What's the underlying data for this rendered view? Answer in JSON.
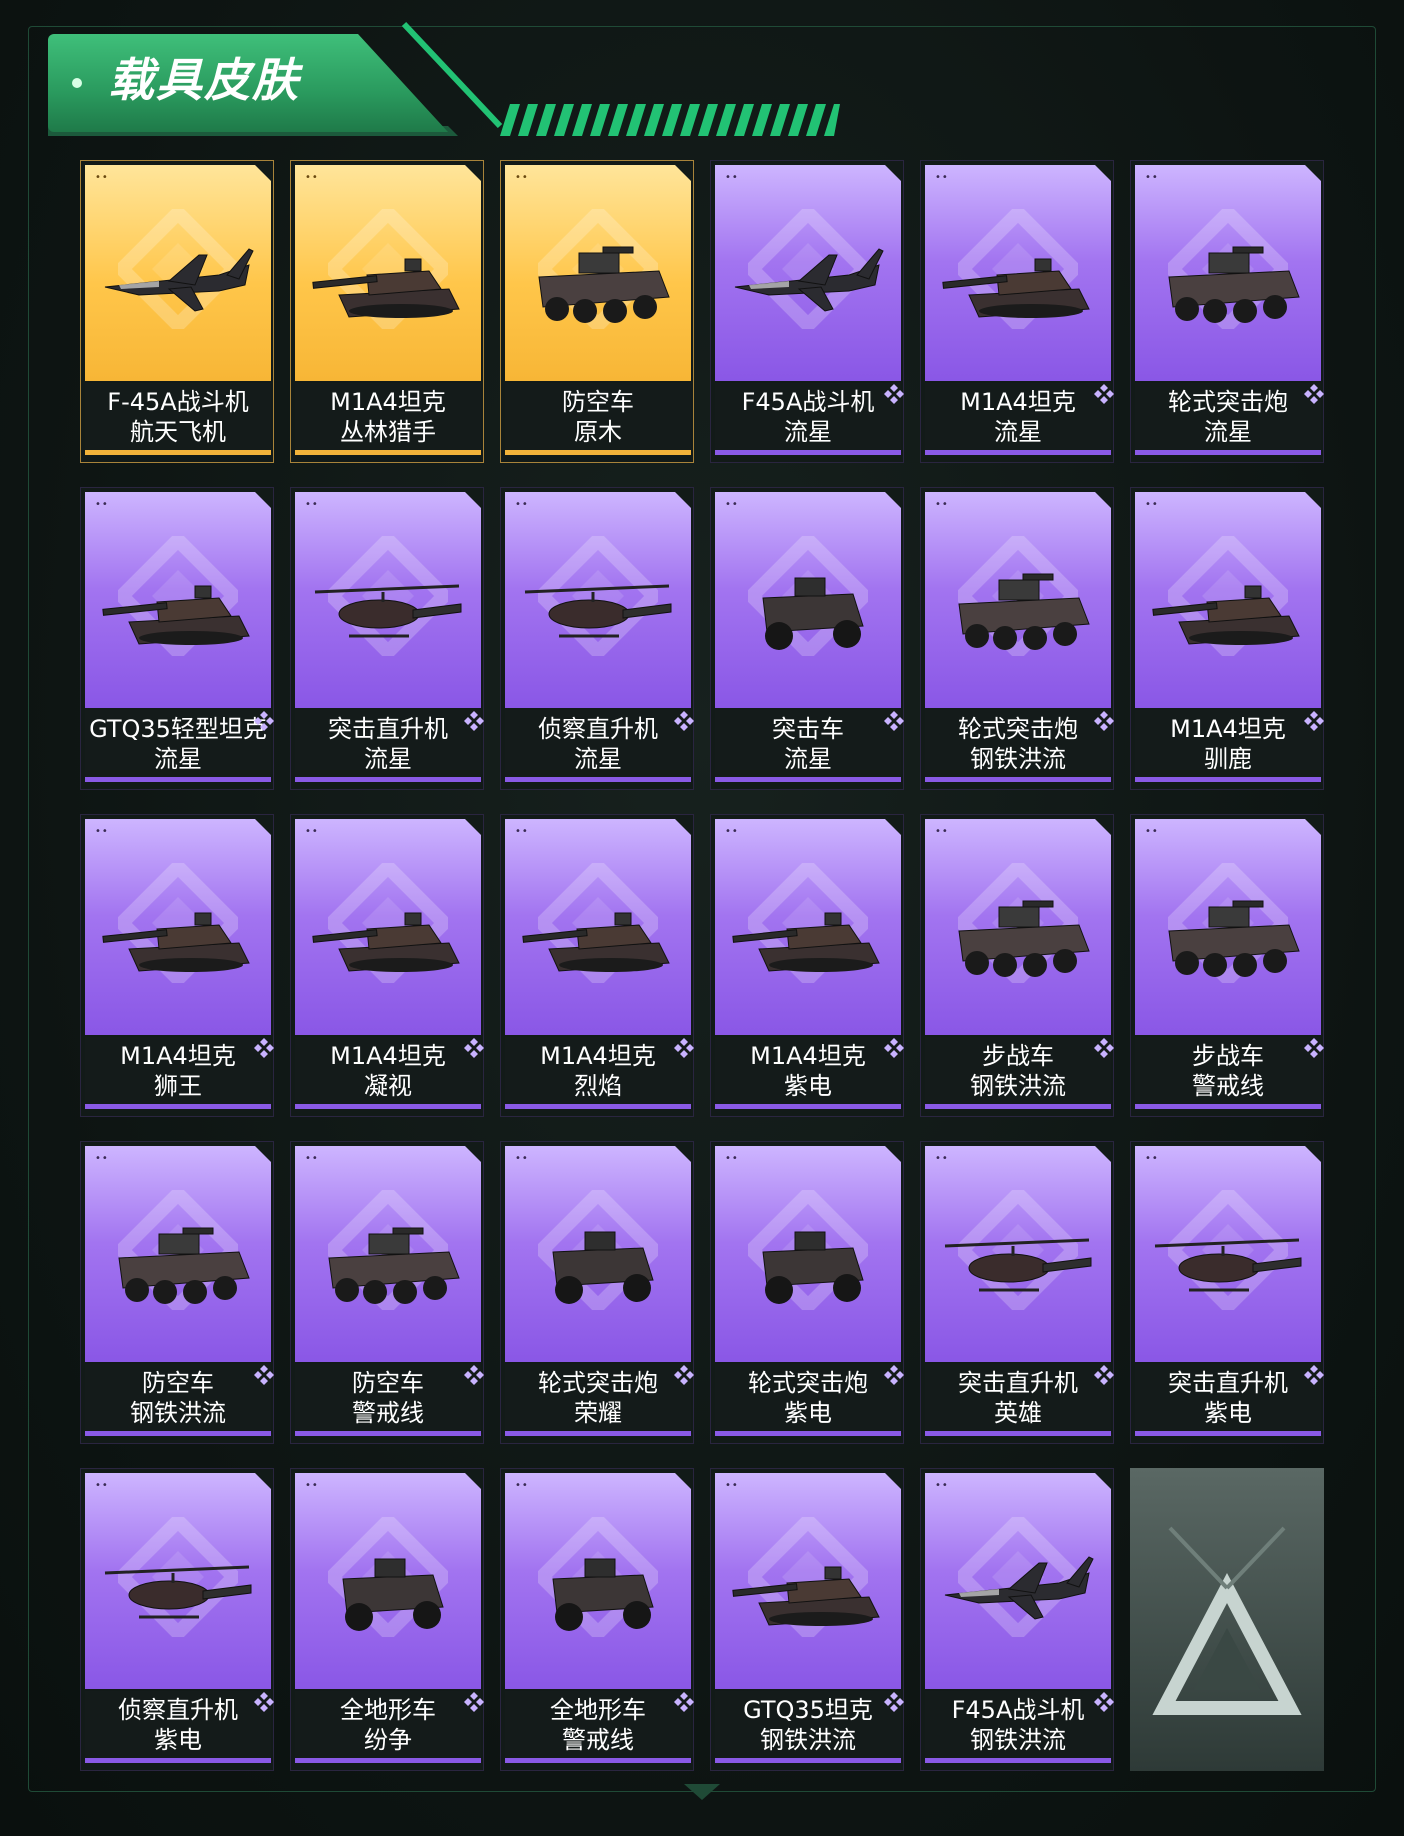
{
  "header": {
    "title": "载具皮肤"
  },
  "colors": {
    "accent_green": "#2fb06c",
    "epic_purple": "#9a68ec",
    "legend_gold": "#ffc64a"
  },
  "cards": [
    {
      "name": "F-45A战斗机",
      "skin": "航天飞机",
      "rarity": "gold",
      "vehicle": "jet"
    },
    {
      "name": "M1A4坦克",
      "skin": "丛林猎手",
      "rarity": "gold",
      "vehicle": "tank"
    },
    {
      "name": "防空车",
      "skin": "原木",
      "rarity": "gold",
      "vehicle": "apc"
    },
    {
      "name": "F45A战斗机",
      "skin": "流星",
      "rarity": "purple",
      "vehicle": "jet"
    },
    {
      "name": "M1A4坦克",
      "skin": "流星",
      "rarity": "purple",
      "vehicle": "tank"
    },
    {
      "name": "轮式突击炮",
      "skin": "流星",
      "rarity": "purple",
      "vehicle": "apc"
    },
    {
      "name": "GTQ35轻型坦克",
      "skin": "流星",
      "rarity": "purple",
      "vehicle": "tank"
    },
    {
      "name": "突击直升机",
      "skin": "流星",
      "rarity": "purple",
      "vehicle": "heli"
    },
    {
      "name": "侦察直升机",
      "skin": "流星",
      "rarity": "purple",
      "vehicle": "heli"
    },
    {
      "name": "突击车",
      "skin": "流星",
      "rarity": "purple",
      "vehicle": "buggy"
    },
    {
      "name": "轮式突击炮",
      "skin": "钢铁洪流",
      "rarity": "purple",
      "vehicle": "apc"
    },
    {
      "name": "M1A4坦克",
      "skin": "驯鹿",
      "rarity": "purple",
      "vehicle": "tank"
    },
    {
      "name": "M1A4坦克",
      "skin": "狮王",
      "rarity": "purple",
      "vehicle": "tank"
    },
    {
      "name": "M1A4坦克",
      "skin": "凝视",
      "rarity": "purple",
      "vehicle": "tank"
    },
    {
      "name": "M1A4坦克",
      "skin": "烈焰",
      "rarity": "purple",
      "vehicle": "tank"
    },
    {
      "name": "M1A4坦克",
      "skin": "紫电",
      "rarity": "purple",
      "vehicle": "tank"
    },
    {
      "name": "步战车",
      "skin": "钢铁洪流",
      "rarity": "purple",
      "vehicle": "apc"
    },
    {
      "name": "步战车",
      "skin": "警戒线",
      "rarity": "purple",
      "vehicle": "apc"
    },
    {
      "name": "防空车",
      "skin": "钢铁洪流",
      "rarity": "purple",
      "vehicle": "apc"
    },
    {
      "name": "防空车",
      "skin": "警戒线",
      "rarity": "purple",
      "vehicle": "apc"
    },
    {
      "name": "轮式突击炮",
      "skin": "荣耀",
      "rarity": "purple",
      "vehicle": "buggy"
    },
    {
      "name": "轮式突击炮",
      "skin": "紫电",
      "rarity": "purple",
      "vehicle": "buggy"
    },
    {
      "name": "突击直升机",
      "skin": "英雄",
      "rarity": "purple",
      "vehicle": "heli"
    },
    {
      "name": "突击直升机",
      "skin": "紫电",
      "rarity": "purple",
      "vehicle": "heli"
    },
    {
      "name": "侦察直升机",
      "skin": "紫电",
      "rarity": "purple",
      "vehicle": "heli"
    },
    {
      "name": "全地形车",
      "skin": "纷争",
      "rarity": "purple",
      "vehicle": "buggy"
    },
    {
      "name": "全地形车",
      "skin": "警戒线",
      "rarity": "purple",
      "vehicle": "buggy"
    },
    {
      "name": "GTQ35坦克",
      "skin": "钢铁洪流",
      "rarity": "purple",
      "vehicle": "tank"
    },
    {
      "name": "F45A战斗机",
      "skin": "钢铁洪流",
      "rarity": "purple",
      "vehicle": "jet"
    }
  ]
}
